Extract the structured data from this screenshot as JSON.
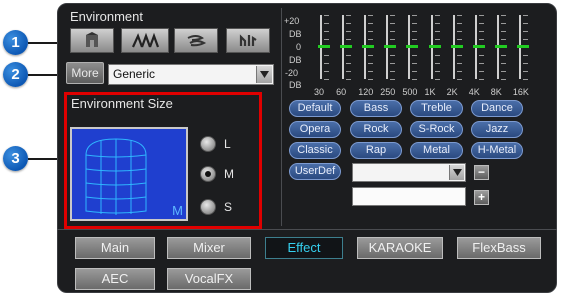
{
  "callouts": [
    "1",
    "2",
    "3"
  ],
  "environment": {
    "label": "Environment",
    "buttons": [
      {
        "name": "environment-button-1",
        "icon": "room-icon"
      },
      {
        "name": "environment-button-2",
        "icon": "stage-icon"
      },
      {
        "name": "environment-button-3",
        "icon": "wind-icon"
      },
      {
        "name": "environment-button-4",
        "icon": "hall-icon"
      }
    ],
    "more_label": "More",
    "preset_value": "Generic"
  },
  "environment_size": {
    "label": "Environment Size",
    "room_indicator": "M",
    "options": [
      "L",
      "M",
      "S"
    ],
    "selected": "M"
  },
  "equalizer": {
    "db_labels": [
      "+20",
      "DB",
      "0",
      "DB",
      "-20",
      "DB"
    ],
    "frequencies": [
      "30",
      "60",
      "120",
      "250",
      "500",
      "1K",
      "2K",
      "4K",
      "8K",
      "16K"
    ],
    "levels": [
      0,
      0,
      0,
      0,
      0,
      0,
      0,
      0,
      0,
      0
    ],
    "presets": [
      "Default",
      "Bass",
      "Treble",
      "Dance",
      "Opera",
      "Rock",
      "S-Rock",
      "Jazz",
      "Classic",
      "Rap",
      "Metal",
      "H-Metal",
      "UserDef"
    ],
    "userdef_select_value": "",
    "userdef_name_value": "",
    "minus_label": "−",
    "plus_label": "+"
  },
  "tabs": [
    "Main",
    "Mixer",
    "Effect",
    "KARAOKE",
    "FlexBass",
    "AEC",
    "VocalFX"
  ],
  "active_tab": "Effect",
  "colors": {
    "panel": "#1c1d1f",
    "callout": "#0d58b4",
    "highlight_frame": "#e00000",
    "slider_center": "#22cc22",
    "active_tab_text": "#35d0ef",
    "preset_fill": "#2b4a80"
  }
}
